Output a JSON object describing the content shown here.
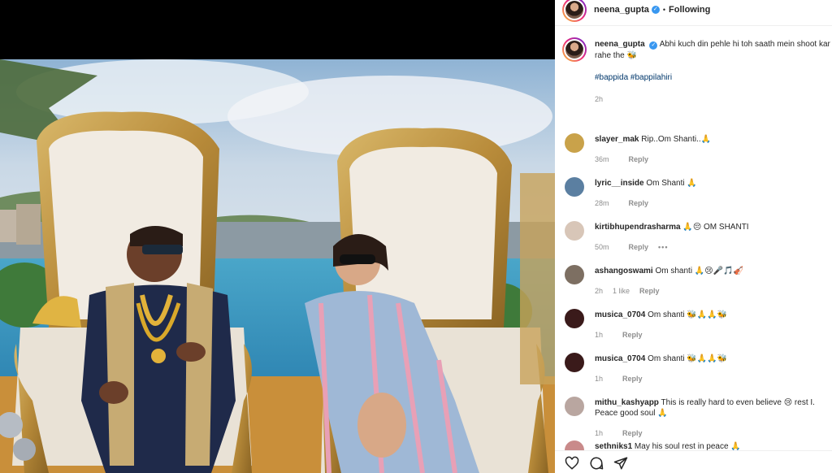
{
  "post": {
    "username": "neena_gupta",
    "status": "Following",
    "separator": "•"
  },
  "caption": {
    "username": "neena_gupta",
    "text": "Abhi kuch din pehle hi toh saath mein shoot kar rahe the 🐝",
    "hashtags": "#bappida #bappilahiri",
    "time": "2h"
  },
  "comments": [
    {
      "username": "slayer_mak",
      "text": "Rip..Om Shanti..🙏",
      "time": "36m",
      "likes": "",
      "reply": "Reply",
      "more": "",
      "color": "#c9a24a"
    },
    {
      "username": "lyric__inside",
      "text": "Om Shanti 🙏",
      "time": "28m",
      "likes": "",
      "reply": "Reply",
      "more": "",
      "color": "#5b7fa1"
    },
    {
      "username": "kirtibhupendrasharma",
      "text": "🙏😔 OM SHANTI",
      "time": "50m",
      "likes": "",
      "reply": "Reply",
      "more": "•••",
      "color": "#d8c6b8"
    },
    {
      "username": "ashangoswami",
      "text": "Om shanti 🙏😢🎤🎵🎻",
      "time": "2h",
      "likes": "1 like",
      "reply": "Reply",
      "more": "",
      "color": "#7d6f62"
    },
    {
      "username": "musica_0704",
      "text": "Om shanti 🐝🙏🙏🐝",
      "time": "1h",
      "likes": "",
      "reply": "Reply",
      "more": "",
      "color": "#3a1a1a"
    },
    {
      "username": "musica_0704",
      "text": "Om shanti 🐝🙏🙏🐝",
      "time": "1h",
      "likes": "",
      "reply": "Reply",
      "more": "",
      "color": "#3a1a1a"
    },
    {
      "username": "mithu_kashyapp",
      "text": "This is really hard to even believe 😢 rest I. Peace good soul 🙏",
      "time": "1h",
      "likes": "",
      "reply": "Reply",
      "more": "",
      "color": "#b9a6a0"
    },
    {
      "username": "sethniks1",
      "text": "May his soul rest in peace 🙏",
      "time": "",
      "likes": "",
      "reply": "",
      "more": "",
      "color": "#c98a8a"
    }
  ],
  "icons": [
    "heart-icon",
    "comment-icon",
    "share-icon"
  ]
}
